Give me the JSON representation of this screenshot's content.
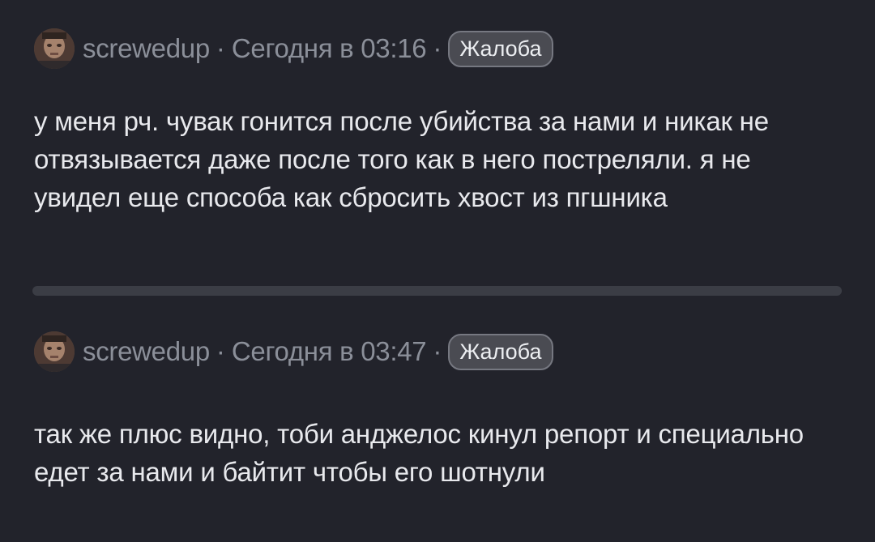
{
  "posts": [
    {
      "username": "screwedup",
      "separator1": "·",
      "timestamp": "Сегодня в 03:16",
      "separator2": "·",
      "report_label": "Жалоба",
      "message": "у меня рч. чувак гонится после убийства за нами и никак не отвязывается даже после того как в него постреляли. я не увидел еще способа как сбросить хвост из пгшника"
    },
    {
      "username": "screwedup",
      "separator1": "·",
      "timestamp": "Сегодня в 03:47",
      "separator2": "·",
      "report_label": "Жалоба",
      "message": "так же плюс видно, тоби анджелос кинул репорт и специально едет за нами и байтит чтобы его шотнули"
    }
  ],
  "colors": {
    "background": "#22232b",
    "meta_text": "#8b8f99",
    "message_text": "#e8e9ed",
    "report_button_bg": "#4a4b52",
    "divider": "#3b3d45"
  }
}
